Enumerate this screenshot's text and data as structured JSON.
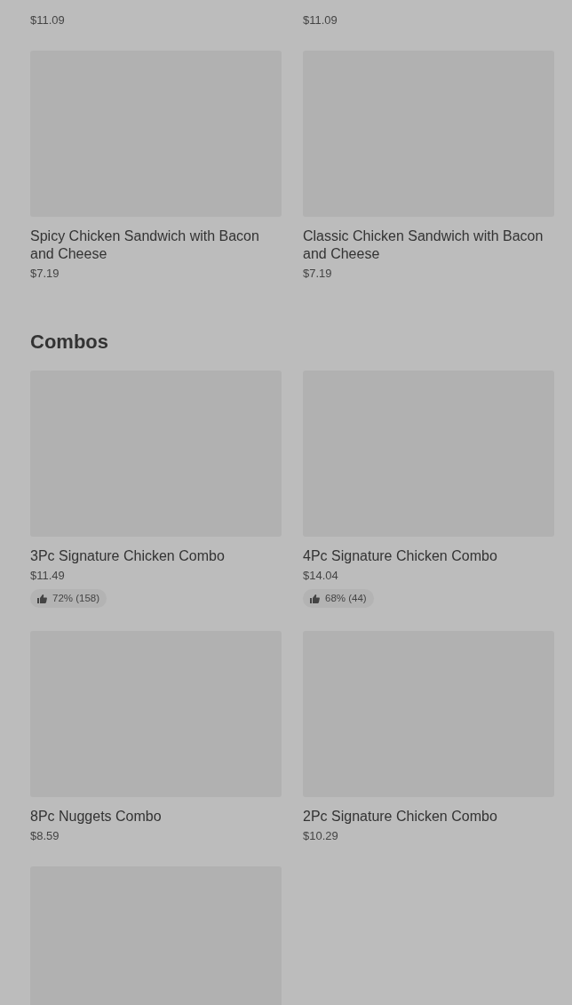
{
  "sections": [
    {
      "items": [
        {
          "image": false,
          "price": "$11.09"
        },
        {
          "image": false,
          "price": "$11.09"
        },
        {
          "image": true,
          "name": "Spicy Chicken Sandwich with Bacon and Cheese",
          "price": "$7.19"
        },
        {
          "image": true,
          "name": "Classic Chicken Sandwich with Bacon and Cheese",
          "price": "$7.19"
        }
      ]
    },
    {
      "title": "Combos",
      "items": [
        {
          "image": true,
          "name": "3Pc Signature Chicken Combo",
          "price": "$11.49",
          "rating": "72% (158)"
        },
        {
          "image": true,
          "name": "4Pc Signature Chicken Combo",
          "price": "$14.04",
          "rating": "68% (44)"
        },
        {
          "image": true,
          "name": "8Pc Nuggets Combo",
          "price": "$8.59"
        },
        {
          "image": true,
          "name": "2Pc Signature Chicken Combo",
          "price": "$10.29"
        },
        {
          "image": true
        }
      ]
    }
  ]
}
